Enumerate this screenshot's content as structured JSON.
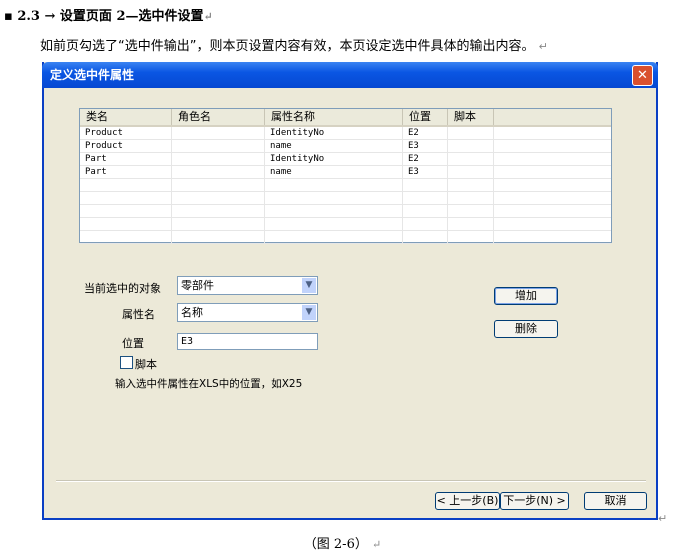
{
  "heading": {
    "number": "2.3",
    "text": "设置页面 2—选中件设置"
  },
  "paragraph": "如前页勾选了“选中件输出”，则本页设置内容有效，本页设定选中件具体的输出内容。",
  "dialog": {
    "title": "定义选中件属性",
    "close": "✕",
    "columns": [
      "类名",
      "角色名",
      "属性名称",
      "位置",
      "脚本"
    ],
    "rows": [
      [
        "Product",
        "",
        "IdentityNo",
        "E2",
        ""
      ],
      [
        "Product",
        "",
        "name",
        "E3",
        ""
      ],
      [
        "Part",
        "",
        "IdentityNo",
        "E2",
        ""
      ],
      [
        "Part",
        "",
        "name",
        "E3",
        ""
      ]
    ],
    "object_label": "当前选中的对象",
    "object_value": "零部件",
    "attr_label": "属性名",
    "attr_value": "名称",
    "pos_label": "位置",
    "pos_value": "E3",
    "script_label": "脚本",
    "hint": "输入选中件属性在XLS中的位置，如X25",
    "add": "增加",
    "delete": "删除",
    "prev": "< 上一步(B)",
    "next": "下一步(N) >",
    "cancel": "取消"
  },
  "caption": "（图 2-6）"
}
